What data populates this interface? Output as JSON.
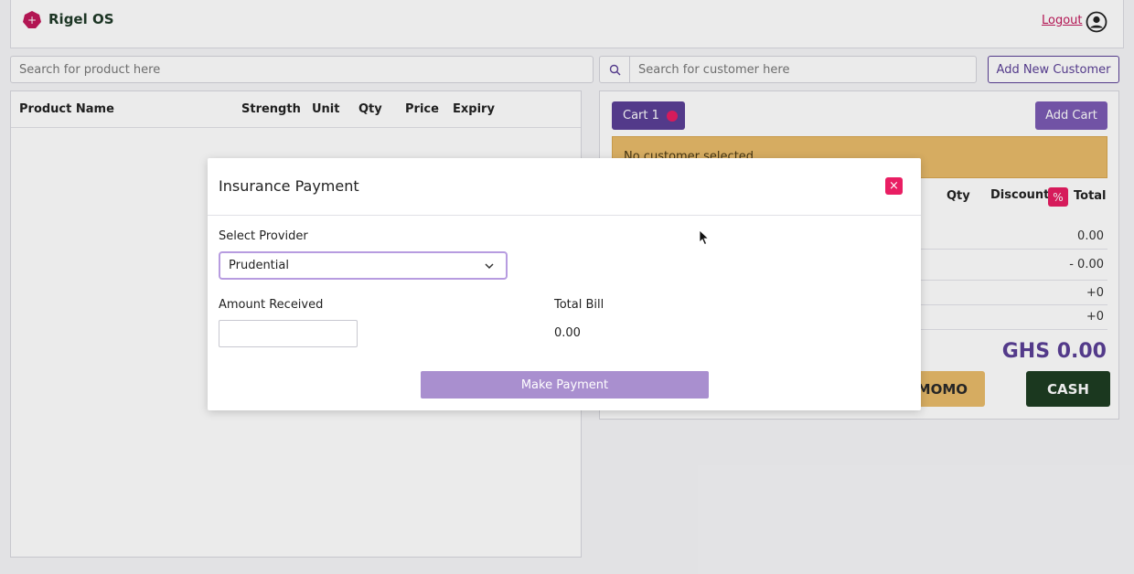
{
  "app": {
    "name": "Rigel OS",
    "logout_label": "Logout",
    "colors": {
      "brand": "#5b3f96",
      "accent": "#e91e63",
      "warning": "#e9bb6a",
      "cash": "#1e3d22"
    }
  },
  "search": {
    "product_placeholder": "Search for product here",
    "customer_placeholder": "Search for customer here",
    "add_customer_label": "Add New Customer"
  },
  "product_table": {
    "columns": [
      "Product Name",
      "Strength",
      "Unit",
      "Qty",
      "Price",
      "Expiry"
    ]
  },
  "cart": {
    "tab_label": "Cart 1",
    "add_cart_label": "Add Cart",
    "alert_text": "No customer selected",
    "columns": {
      "qty": "Qty",
      "discount": "Discount",
      "discount_icon": "%",
      "total": "Total"
    },
    "summary": [
      "0.00",
      "- 0.00",
      "+0",
      "+0"
    ],
    "grand_total": "GHS 0.00",
    "momo_label": "MOMO",
    "cash_label": "CASH"
  },
  "modal": {
    "title": "Insurance Payment",
    "close_icon": "×",
    "provider_label": "Select Provider",
    "provider_value": "Prudential",
    "amount_label": "Amount Received",
    "amount_value": "",
    "total_bill_label": "Total Bill",
    "total_bill_value": "0.00",
    "pay_button_label": "Make Payment"
  }
}
